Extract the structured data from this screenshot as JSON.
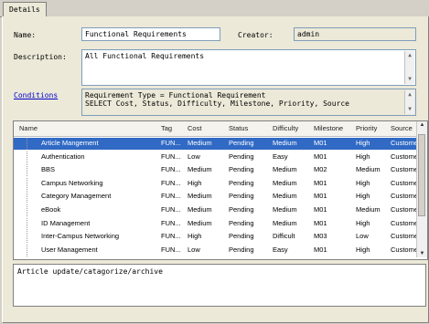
{
  "tab": {
    "label": "Details"
  },
  "form": {
    "name_label": "Name:",
    "name_value": "Functional Requirements",
    "creator_label": "Creator:",
    "creator_value": "admin",
    "description_label": "Description:",
    "description_value": "All Functional Requirements",
    "conditions_link": "Conditions",
    "conditions_line1": "Requirement Type = Functional Requirement",
    "conditions_line2": "SELECT Cost, Status, Difficulty, Milestone, Priority, Source"
  },
  "grid": {
    "headers": [
      "Name",
      "Tag",
      "Cost",
      "Status",
      "Difficulty",
      "Milestone",
      "Priority",
      "Source"
    ],
    "rows": [
      [
        "Article Mangement",
        "FUN...",
        "Medium",
        "Pending",
        "Medium",
        "M01",
        "High",
        "Customer"
      ],
      [
        "Authentication",
        "FUN...",
        "Low",
        "Pending",
        "Easy",
        "M01",
        "High",
        "Customer"
      ],
      [
        "BBS",
        "FUN...",
        "Medium",
        "Pending",
        "Medium",
        "M02",
        "Medium",
        "Customer"
      ],
      [
        "Campus Networking",
        "FUN...",
        "High",
        "Pending",
        "Medium",
        "M01",
        "High",
        "Customer"
      ],
      [
        "Category Management",
        "FUN...",
        "Medium",
        "Pending",
        "Medium",
        "M01",
        "High",
        "Customer"
      ],
      [
        "eBook",
        "FUN...",
        "Medium",
        "Pending",
        "Medium",
        "M01",
        "Medium",
        "Customer"
      ],
      [
        "ID Management",
        "FUN...",
        "Medium",
        "Pending",
        "Medium",
        "M01",
        "High",
        "Customer"
      ],
      [
        "Inter-Campus Networking",
        "FUN...",
        "High",
        "Pending",
        "Difficult",
        "M03",
        "Low",
        "Customer"
      ],
      [
        "User Management",
        "FUN...",
        "Low",
        "Pending",
        "Easy",
        "M01",
        "High",
        "Customer"
      ]
    ],
    "selected_index": 0
  },
  "notes": {
    "value": "Article update/catagorize/archive"
  }
}
